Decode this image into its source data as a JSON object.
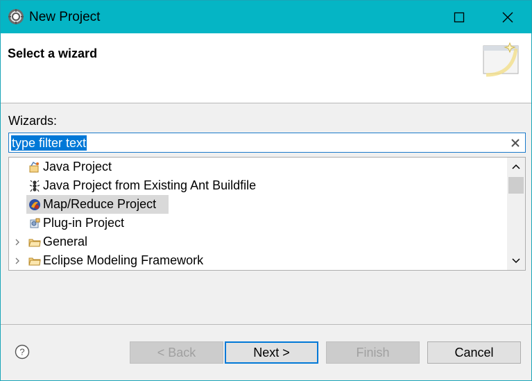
{
  "window": {
    "title": "New Project"
  },
  "header": {
    "title": "Select a wizard"
  },
  "wizards": {
    "label": "Wizards:",
    "filter_value": "type filter text",
    "items": [
      {
        "label": "Java Project",
        "icon": "java-project-icon",
        "expandable": false,
        "selected": false
      },
      {
        "label": "Java Project from Existing Ant Buildfile",
        "icon": "ant-icon",
        "expandable": false,
        "selected": false
      },
      {
        "label": "Map/Reduce Project",
        "icon": "mapreduce-icon",
        "expandable": false,
        "selected": true
      },
      {
        "label": "Plug-in Project",
        "icon": "plugin-icon",
        "expandable": false,
        "selected": false
      },
      {
        "label": "General",
        "icon": "folder-icon",
        "expandable": true,
        "selected": false
      },
      {
        "label": "Eclipse Modeling Framework",
        "icon": "folder-icon",
        "expandable": true,
        "selected": false
      }
    ]
  },
  "buttons": {
    "back": "< Back",
    "next": "Next >",
    "finish": "Finish",
    "cancel": "Cancel"
  },
  "colors": {
    "titlebar": "#05b5c5",
    "selection": "#0078d7",
    "selected_row": "#d9d9d9"
  }
}
